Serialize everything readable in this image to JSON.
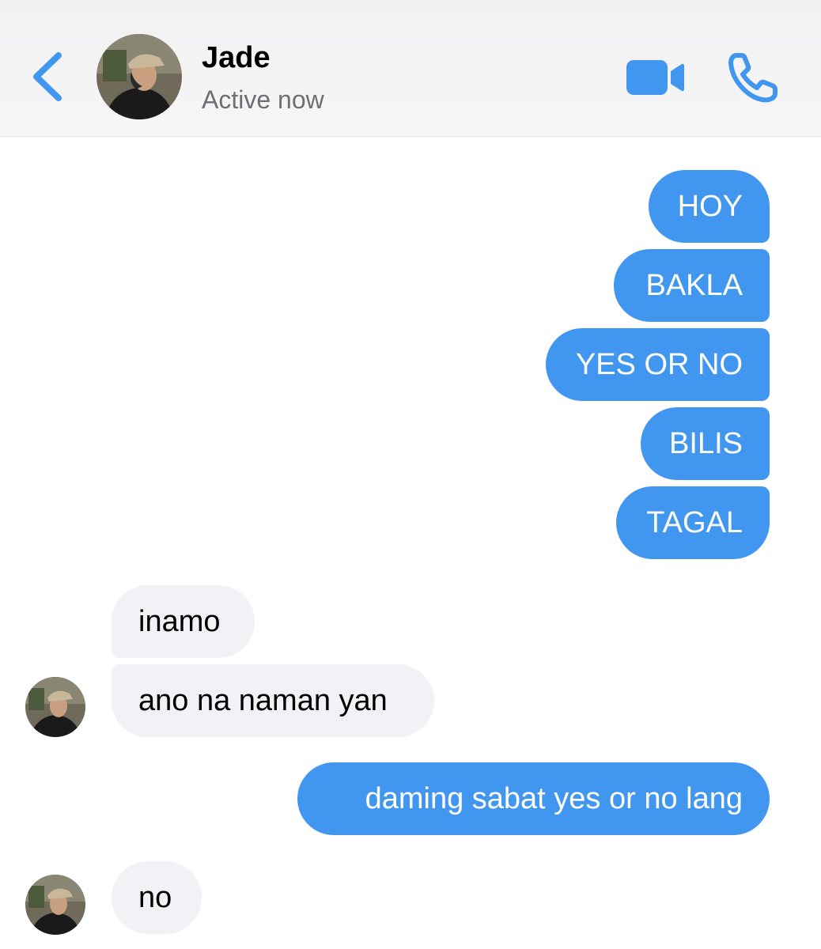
{
  "header": {
    "contact_name": "Jade",
    "status": "Active now",
    "icons": {
      "back": "chevron-left-icon",
      "video": "video-camera-icon",
      "call": "phone-icon"
    },
    "accent_color": "#4197f0"
  },
  "messages": [
    {
      "direction": "outgoing",
      "text": "HOY"
    },
    {
      "direction": "outgoing",
      "text": "BAKLA"
    },
    {
      "direction": "outgoing",
      "text": "YES OR NO"
    },
    {
      "direction": "outgoing",
      "text": "BILIS"
    },
    {
      "direction": "outgoing",
      "text": "TAGAL"
    },
    {
      "direction": "incoming",
      "text": "inamo"
    },
    {
      "direction": "incoming",
      "text": "ano na naman yan"
    },
    {
      "direction": "outgoing",
      "text": "daming sabat yes or no lang"
    },
    {
      "direction": "incoming",
      "text": "no"
    }
  ],
  "colors": {
    "outgoing_bubble": "#4197f0",
    "incoming_bubble": "#f1f1f6"
  }
}
